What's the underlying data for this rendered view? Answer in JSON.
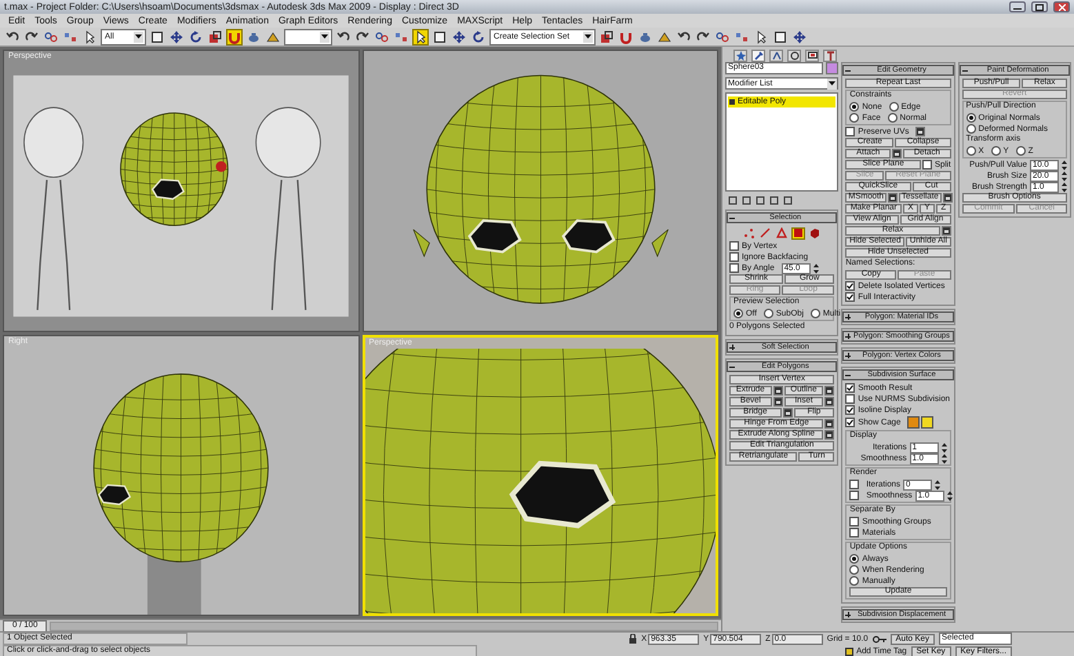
{
  "window": {
    "title": "t.max - Project Folder: C:\\Users\\hsoam\\Documents\\3dsmax - Autodesk 3ds Max 2009 - Display : Direct 3D"
  },
  "menu": [
    "Edit",
    "Tools",
    "Group",
    "Views",
    "Create",
    "Modifiers",
    "Animation",
    "Graph Editors",
    "Rendering",
    "Customize",
    "MAXScript",
    "Help",
    "Tentacles",
    "HairFarm"
  ],
  "toolbar": [
    {
      "kind": "tool",
      "selected": false
    },
    {
      "kind": "tool",
      "selected": false
    },
    {
      "kind": "tool",
      "selected": false
    },
    {
      "kind": "tool",
      "selected": false
    },
    {
      "kind": "tool",
      "selected": false
    },
    {
      "kind": "dropdown",
      "value": "All"
    },
    {
      "kind": "tool",
      "selected": false
    },
    {
      "kind": "tool",
      "selected": false
    },
    {
      "kind": "tool",
      "selected": false
    },
    {
      "kind": "tool",
      "selected": false
    },
    {
      "kind": "tool",
      "selected": true
    },
    {
      "kind": "tool",
      "selected": false
    },
    {
      "kind": "tool",
      "selected": false
    },
    {
      "kind": "dropdown"
    },
    {
      "kind": "tool",
      "selected": false
    },
    {
      "kind": "tool",
      "selected": false
    },
    {
      "kind": "tool",
      "selected": false
    },
    {
      "kind": "tool",
      "selected": false
    },
    {
      "kind": "tool",
      "selected": true
    },
    {
      "kind": "tool",
      "selected": false
    },
    {
      "kind": "tool",
      "selected": false
    },
    {
      "kind": "tool",
      "selected": false
    },
    {
      "kind": "dropdown",
      "value": "Create Selection Set"
    },
    {
      "kind": "tool",
      "selected": false
    },
    {
      "kind": "tool",
      "selected": false
    },
    {
      "kind": "tool",
      "selected": false
    },
    {
      "kind": "tool",
      "selected": false
    },
    {
      "kind": "tool",
      "selected": false
    },
    {
      "kind": "tool",
      "selected": false
    },
    {
      "kind": "tool",
      "selected": false
    },
    {
      "kind": "tool",
      "selected": false
    },
    {
      "kind": "tool",
      "selected": false
    },
    {
      "kind": "tool",
      "selected": false
    },
    {
      "kind": "tool",
      "selected": false
    }
  ],
  "viewports": [
    {
      "label": "Perspective",
      "kind": "reference",
      "active": false
    },
    {
      "kind": "front",
      "active": false
    },
    {
      "label": "Right",
      "kind": "side",
      "active": false
    },
    {
      "label": "Perspective",
      "kind": "closeup",
      "active": true
    }
  ],
  "command_panel": {
    "tabs": [
      {
        "selected": false
      },
      {
        "selected": true
      },
      {
        "selected": false
      },
      {
        "selected": false
      },
      {
        "selected": false
      },
      {
        "selected": false
      }
    ],
    "object_name": "Sphere03",
    "modifier_list": "Modifier List",
    "stack": [
      {
        "label": "Editable Poly",
        "selected": true
      }
    ],
    "columns": [
      {
        "rollouts": [
          {
            "title": "Selection",
            "expanded": true,
            "items": [
              {
                "kind": "subobjects",
                "items": [
                  {
                    "selected": false
                  },
                  {
                    "selected": false
                  },
                  {
                    "selected": false
                  },
                  {
                    "selected": true
                  },
                  {
                    "selected": false
                  }
                ]
              },
              {
                "kind": "checkbox",
                "label": "By Vertex",
                "checked": false
              },
              {
                "kind": "checkbox",
                "label": "Ignore Backfacing",
                "checked": false
              },
              {
                "kind": "row",
                "items": [
                  {
                    "kind": "checkbox",
                    "label": "By Angle",
                    "checked": false
                  },
                  {
                    "kind": "spinner",
                    "value": "45.0"
                  }
                ]
              },
              {
                "kind": "row",
                "items": [
                  {
                    "kind": "button",
                    "label": "Shrink",
                    "disabled": false
                  },
                  {
                    "kind": "button",
                    "label": "Grow",
                    "disabled": false
                  }
                ]
              },
              {
                "kind": "row",
                "items": [
                  {
                    "kind": "button",
                    "label": "Ring",
                    "disabled": true
                  },
                  {
                    "kind": "button",
                    "label": "Loop",
                    "disabled": true
                  }
                ]
              },
              {
                "kind": "group",
                "title": "Preview Selection",
                "items": [
                  {
                    "kind": "row",
                    "items": [
                      {
                        "kind": "radio",
                        "label": "Off",
                        "selected": true
                      },
                      {
                        "kind": "radio",
                        "label": "SubObj",
                        "selected": false
                      },
                      {
                        "kind": "radio",
                        "label": "Multi",
                        "selected": false
                      }
                    ]
                  }
                ]
              },
              {
                "kind": "text",
                "text": "0 Polygons Selected"
              }
            ]
          },
          {
            "title": "Soft Selection",
            "expanded": false
          },
          {
            "title": "Edit Polygons",
            "expanded": true,
            "items": [
              {
                "kind": "button",
                "label": "Insert Vertex",
                "disabled": false
              },
              {
                "kind": "row",
                "items": [
                  {
                    "kind": "button",
                    "label": "Extrude",
                    "disabled": false
                  },
                  {
                    "kind": "settings"
                  },
                  {
                    "kind": "button",
                    "label": "Outline",
                    "disabled": false
                  },
                  {
                    "kind": "settings"
                  }
                ]
              },
              {
                "kind": "row",
                "items": [
                  {
                    "kind": "button",
                    "label": "Bevel",
                    "disabled": false
                  },
                  {
                    "kind": "settings"
                  },
                  {
                    "kind": "button",
                    "label": "Inset",
                    "disabled": false
                  },
                  {
                    "kind": "settings"
                  }
                ]
              },
              {
                "kind": "row",
                "items": [
                  {
                    "kind": "button",
                    "label": "Bridge",
                    "disabled": false
                  },
                  {
                    "kind": "settings"
                  },
                  {
                    "kind": "button",
                    "label": "Flip",
                    "disabled": false
                  }
                ]
              },
              {
                "kind": "row",
                "items": [
                  {
                    "kind": "button",
                    "label": "Hinge From Edge",
                    "disabled": false
                  },
                  {
                    "kind": "settings"
                  }
                ]
              },
              {
                "kind": "row",
                "items": [
                  {
                    "kind": "button",
                    "label": "Extrude Along Spline",
                    "disabled": false
                  },
                  {
                    "kind": "settings"
                  }
                ]
              },
              {
                "kind": "button",
                "label": "Edit Triangulation",
                "disabled": false
              },
              {
                "kind": "row",
                "items": [
                  {
                    "kind": "button",
                    "label": "Retriangulate",
                    "disabled": false
                  },
                  {
                    "kind": "button",
                    "label": "Turn",
                    "disabled": false
                  }
                ]
              }
            ]
          }
        ]
      },
      {
        "rollouts": [
          {
            "title": "Edit Geometry",
            "expanded": true,
            "items": [
              {
                "kind": "button",
                "label": "Repeat Last",
                "disabled": false
              },
              {
                "kind": "group",
                "title": "Constraints",
                "items": [
                  {
                    "kind": "row",
                    "items": [
                      {
                        "kind": "radio",
                        "label": "None",
                        "selected": true
                      },
                      {
                        "kind": "radio",
                        "label": "Edge",
                        "selected": false
                      }
                    ]
                  },
                  {
                    "kind": "row",
                    "items": [
                      {
                        "kind": "radio",
                        "label": "Face",
                        "selected": false
                      },
                      {
                        "kind": "radio",
                        "label": "Normal",
                        "selected": false
                      }
                    ]
                  }
                ]
              },
              {
                "kind": "row",
                "items": [
                  {
                    "kind": "checkbox",
                    "label": "Preserve UVs",
                    "checked": false
                  },
                  {
                    "kind": "settings"
                  }
                ]
              },
              {
                "kind": "row",
                "items": [
                  {
                    "kind": "button",
                    "label": "Create",
                    "disabled": false
                  },
                  {
                    "kind": "button",
                    "label": "Collapse",
                    "disabled": false
                  }
                ]
              },
              {
                "kind": "row",
                "items": [
                  {
                    "kind": "button",
                    "label": "Attach",
                    "disabled": false
                  },
                  {
                    "kind": "settings"
                  },
                  {
                    "kind": "button",
                    "label": "Detach",
                    "disabled": false
                  }
                ]
              },
              {
                "kind": "row",
                "items": [
                  {
                    "kind": "button",
                    "label": "Slice Plane",
                    "disabled": false
                  },
                  {
                    "kind": "checkbox",
                    "label": "Split",
                    "checked": false
                  }
                ]
              },
              {
                "kind": "row",
                "items": [
                  {
                    "kind": "button",
                    "label": "Slice",
                    "disabled": true
                  },
                  {
                    "kind": "button",
                    "label": "Reset Plane",
                    "disabled": true
                  }
                ]
              },
              {
                "kind": "row",
                "items": [
                  {
                    "kind": "button",
                    "label": "QuickSlice",
                    "disabled": false
                  },
                  {
                    "kind": "button",
                    "label": "Cut",
                    "disabled": false
                  }
                ]
              },
              {
                "kind": "row",
                "items": [
                  {
                    "kind": "button",
                    "label": "MSmooth",
                    "disabled": false
                  },
                  {
                    "kind": "settings"
                  },
                  {
                    "kind": "button",
                    "label": "Tessellate",
                    "disabled": false
                  },
                  {
                    "kind": "settings"
                  }
                ]
              },
              {
                "kind": "row",
                "items": [
                  {
                    "kind": "button",
                    "label": "Make Planar",
                    "disabled": false
                  },
                  {
                    "kind": "button",
                    "label": "X",
                    "disabled": false
                  },
                  {
                    "kind": "button",
                    "label": "Y",
                    "disabled": false
                  },
                  {
                    "kind": "button",
                    "label": "Z",
                    "disabled": false
                  }
                ]
              },
              {
                "kind": "row",
                "items": [
                  {
                    "kind": "button",
                    "label": "View Align",
                    "disabled": false
                  },
                  {
                    "kind": "button",
                    "label": "Grid Align",
                    "disabled": false
                  }
                ]
              },
              {
                "kind": "row",
                "items": [
                  {
                    "kind": "button",
                    "label": "Relax",
                    "disabled": false
                  },
                  {
                    "kind": "settings"
                  }
                ]
              },
              {
                "kind": "row",
                "items": [
                  {
                    "kind": "button",
                    "label": "Hide Selected",
                    "disabled": false
                  },
                  {
                    "kind": "button",
                    "label": "Unhide All",
                    "disabled": false
                  }
                ]
              },
              {
                "kind": "button",
                "label": "Hide Unselected",
                "disabled": false
              },
              {
                "kind": "text",
                "text": "Named Selections:"
              },
              {
                "kind": "row",
                "items": [
                  {
                    "kind": "button",
                    "label": "Copy",
                    "disabled": false
                  },
                  {
                    "kind": "button",
                    "label": "Paste",
                    "disabled": true
                  }
                ]
              },
              {
                "kind": "checkbox",
                "label": "Delete Isolated Vertices",
                "checked": true
              },
              {
                "kind": "checkbox",
                "label": "Full Interactivity",
                "checked": true
              }
            ]
          },
          {
            "title": "Polygon: Material IDs",
            "expanded": false
          },
          {
            "title": "Polygon: Smoothing Groups",
            "expanded": false
          },
          {
            "title": "Polygon: Vertex Colors",
            "expanded": false
          },
          {
            "title": "Subdivision Surface",
            "expanded": true,
            "items": [
              {
                "kind": "checkbox",
                "label": "Smooth Result",
                "checked": true
              },
              {
                "kind": "checkbox",
                "label": "Use NURMS Subdivision",
                "checked": false
              },
              {
                "kind": "checkbox",
                "label": "Isoline Display",
                "checked": true
              },
              {
                "kind": "row",
                "items": [
                  {
                    "kind": "checkbox",
                    "label": "Show Cage",
                    "checked": true
                  },
                  {
                    "kind": "swatch",
                    "color": "#e08a10"
                  },
                  {
                    "kind": "swatch",
                    "color": "#f0d820"
                  }
                ]
              },
              {
                "kind": "group",
                "title": "Display",
                "items": [
                  {
                    "kind": "spinner",
                    "label": "Iterations",
                    "value": "1"
                  },
                  {
                    "kind": "spinner",
                    "label": "Smoothness",
                    "value": "1.0"
                  }
                ]
              },
              {
                "kind": "group",
                "title": "Render",
                "items": [
                  {
                    "kind": "row",
                    "items": [
                      {
                        "kind": "checkbox",
                        "checked": false
                      },
                      {
                        "kind": "spinner",
                        "label": "Iterations",
                        "value": "0"
                      }
                    ]
                  },
                  {
                    "kind": "row",
                    "items": [
                      {
                        "kind": "checkbox",
                        "checked": false
                      },
                      {
                        "kind": "spinner",
                        "label": "Smoothness",
                        "value": "1.0"
                      }
                    ]
                  }
                ]
              },
              {
                "kind": "group",
                "title": "Separate By",
                "items": [
                  {
                    "kind": "checkbox",
                    "label": "Smoothing Groups",
                    "checked": false
                  },
                  {
                    "kind": "checkbox",
                    "label": "Materials",
                    "checked": false
                  }
                ]
              },
              {
                "kind": "group",
                "title": "Update Options",
                "items": [
                  {
                    "kind": "radio",
                    "label": "Always",
                    "selected": true
                  },
                  {
                    "kind": "radio",
                    "label": "When Rendering",
                    "selected": false
                  },
                  {
                    "kind": "radio",
                    "label": "Manually",
                    "selected": false
                  },
                  {
                    "kind": "button",
                    "label": "Update",
                    "disabled": false
                  }
                ]
              }
            ]
          },
          {
            "title": "Subdivision Displacement",
            "expanded": false
          }
        ]
      },
      {
        "rollouts": [
          {
            "title": "Paint Deformation",
            "expanded": true,
            "items": [
              {
                "kind": "row",
                "items": [
                  {
                    "kind": "button",
                    "label": "Push/Pull",
                    "disabled": false
                  },
                  {
                    "kind": "button",
                    "label": "Relax",
                    "disabled": false
                  }
                ]
              },
              {
                "kind": "button",
                "label": "Revert",
                "disabled": true
              },
              {
                "kind": "group",
                "title": "Push/Pull Direction",
                "items": [
                  {
                    "kind": "radio",
                    "label": "Original Normals",
                    "selected": true
                  },
                  {
                    "kind": "radio",
                    "label": "Deformed Normals",
                    "selected": false
                  },
                  {
                    "kind": "text",
                    "text": "Transform axis"
                  },
                  {
                    "kind": "row",
                    "items": [
                      {
                        "kind": "radio",
                        "label": "X",
                        "selected": false
                      },
                      {
                        "kind": "radio",
                        "label": "Y",
                        "selected": false
                      },
                      {
                        "kind": "radio",
                        "label": "Z",
                        "selected": false
                      }
                    ]
                  }
                ]
              },
              {
                "kind": "spinner",
                "label": "Push/Pull Value",
                "value": "10.0"
              },
              {
                "kind": "spinner",
                "label": "Brush Size",
                "value": "20.0"
              },
              {
                "kind": "spinner",
                "label": "Brush Strength",
                "value": "1.0"
              },
              {
                "kind": "button",
                "label": "Brush Options",
                "disabled": false
              },
              {
                "kind": "row",
                "items": [
                  {
                    "kind": "button",
                    "label": "Commit",
                    "disabled": true
                  },
                  {
                    "kind": "button",
                    "label": "Cancel",
                    "disabled": true
                  }
                ]
              }
            ]
          }
        ]
      }
    ]
  },
  "time_slider": "0 / 100",
  "status_bar": {
    "selection": "1 Object Selected",
    "prompt": "Click or click-and-drag to select objects",
    "coordinates": [
      {
        "label": "X",
        "value": "963.35"
      },
      {
        "label": "Y",
        "value": "790.504"
      },
      {
        "label": "Z",
        "value": "0.0"
      }
    ],
    "grid": "Grid = 10.0",
    "auto_key": "Auto Key",
    "key_mode": "Selected",
    "time_tag": "Add Time Tag",
    "set_key": "Set Key",
    "key_filters": "Key Filters..."
  }
}
